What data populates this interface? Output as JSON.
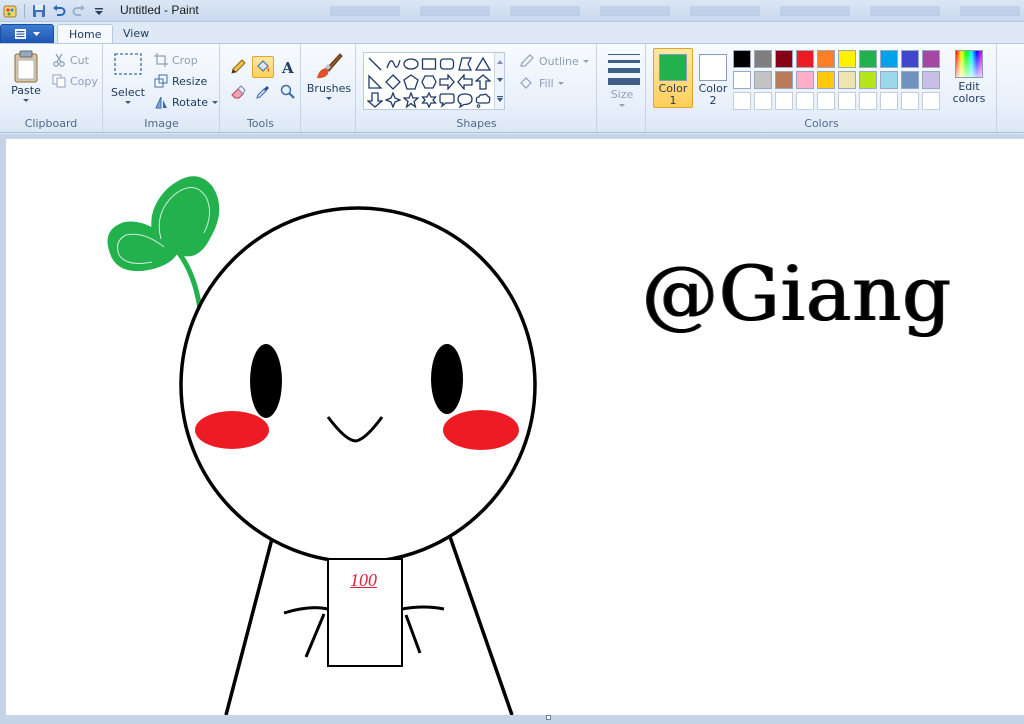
{
  "window": {
    "title": "Untitled - Paint"
  },
  "tabs": [
    {
      "label": "Home",
      "active": true
    },
    {
      "label": "View",
      "active": false
    }
  ],
  "clipboard": {
    "label": "Clipboard",
    "paste": "Paste",
    "cut": "Cut",
    "copy": "Copy"
  },
  "image": {
    "label": "Image",
    "select": "Select",
    "crop": "Crop",
    "resize": "Resize",
    "rotate": "Rotate"
  },
  "tools": {
    "label": "Tools"
  },
  "brushes": {
    "label": "Brushes"
  },
  "shapes": {
    "label": "Shapes",
    "outline": "Outline",
    "fill": "Fill"
  },
  "size": {
    "label": "Size"
  },
  "colors": {
    "label": "Colors",
    "color1_label": "Color\n1",
    "color2_label": "Color\n2",
    "color1": "#22b14c",
    "color2": "#ffffff",
    "edit_label": "Edit colors",
    "palette": [
      "#000000",
      "#7f7f7f",
      "#880015",
      "#ed1c24",
      "#ff7f27",
      "#fff200",
      "#22b14c",
      "#00a2e8",
      "#3f48cc",
      "#a349a4",
      "#ffffff",
      "#c3c3c3",
      "#b97a57",
      "#ffaec9",
      "#ffc90e",
      "#efe4b0",
      "#b5e61d",
      "#99d9ea",
      "#7092be",
      "#c8bfe7",
      "#ffffff",
      "#ffffff",
      "#ffffff",
      "#ffffff",
      "#ffffff",
      "#ffffff",
      "#ffffff",
      "#ffffff",
      "#ffffff",
      "#ffffff"
    ]
  },
  "drawing": {
    "signature": "@Giang",
    "card_text": "100",
    "sprout_color": "#22b14c",
    "cheek_color": "#ed1c24"
  }
}
